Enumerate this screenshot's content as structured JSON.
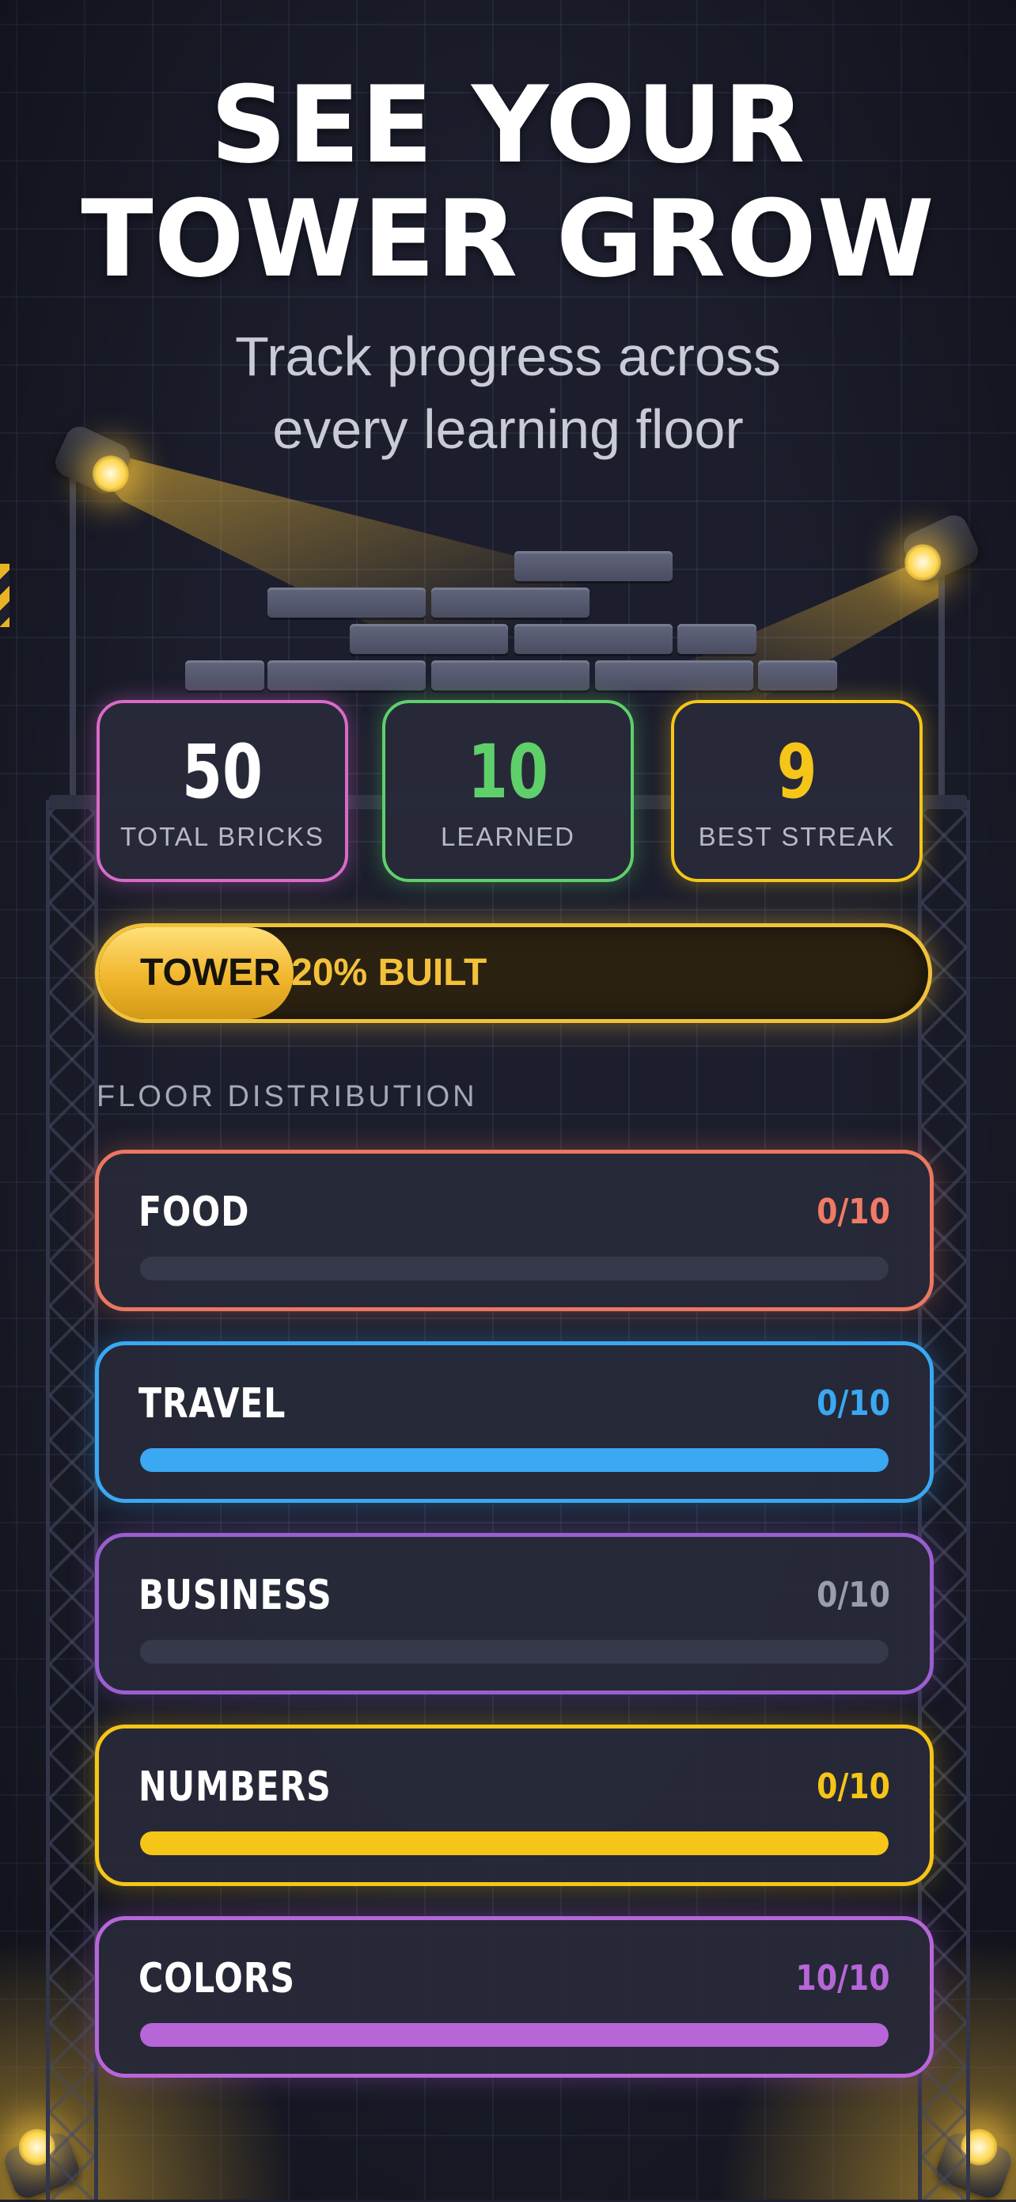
{
  "header": {
    "title_line1": "SEE YOUR",
    "title_line2": "TOWER GROW",
    "subtitle_line1": "Track progress across",
    "subtitle_line2": "every learning floor"
  },
  "stats": [
    {
      "value": "50",
      "label": "TOTAL BRICKS",
      "color": "#d96ac8"
    },
    {
      "value": "10",
      "label": "LEARNED",
      "color": "#5fcf6a"
    },
    {
      "value": "9",
      "label": "BEST STREAK",
      "color": "#f5c518"
    }
  ],
  "progress": {
    "label_part1": "TOWER",
    "label_part2": "20% BUILT",
    "percent": 20,
    "color": "#f0c13a"
  },
  "floor_section": {
    "title": "FLOOR DISTRIBUTION",
    "floors": [
      {
        "name": "FOOD",
        "count": "0/10",
        "fill_fraction": 0.0,
        "border": "#ea7761",
        "count_color": "#f07a66",
        "bar_color": "#ea7761"
      },
      {
        "name": "TRAVEL",
        "count": "0/10",
        "fill_fraction": 1.0,
        "border": "#3aa8f2",
        "count_color": "#3aa8f2",
        "bar_color": "#3aa8f2"
      },
      {
        "name": "BUSINESS",
        "count": "0/10",
        "fill_fraction": 0.0,
        "border": "#9a5fd0",
        "count_color": "#9a9dab",
        "bar_color": "#9a5fd0"
      },
      {
        "name": "NUMBERS",
        "count": "0/10",
        "fill_fraction": 1.0,
        "border": "#f5c518",
        "count_color": "#f5c518",
        "bar_color": "#f5c518"
      },
      {
        "name": "COLORS",
        "count": "10/10",
        "fill_fraction": 1.0,
        "border": "#b766d8",
        "count_color": "#b766d8",
        "bar_color": "#b766d8"
      }
    ]
  },
  "icons": {
    "spotlights": "spotlight-icon",
    "bricks": "brick-wall-icon"
  }
}
